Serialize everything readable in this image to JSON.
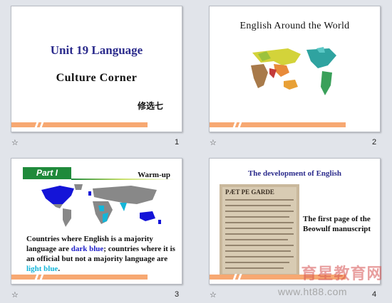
{
  "slides": [
    {
      "number": "1",
      "star": "☆",
      "title": "Unit 19 Language",
      "subtitle": "Culture Corner",
      "author": "修选七"
    },
    {
      "number": "2",
      "star": "☆",
      "title": "English Around the World"
    },
    {
      "number": "3",
      "star": "☆",
      "part_label": "Part I",
      "section": "Warm-up",
      "text_before": "Countries where English is a majority language are ",
      "dark_blue_text": "dark blue",
      "text_middle": "; countries where it is an official but not a majority language are ",
      "light_blue_text": "light blue",
      "text_after": "."
    },
    {
      "number": "4",
      "star": "☆",
      "title": "The development of English",
      "caption": "The first page of the Beowulf manuscript",
      "manuscript_heading": "PÆT PE GARDE"
    }
  ],
  "watermark": {
    "brand": "育星教育网",
    "url": "www.ht88.com"
  },
  "colors": {
    "title_blue": "#2b2b8c",
    "accent_orange": "#f7a872",
    "part_green": "#1f8a3b",
    "dark_blue": "#2020c8",
    "light_blue": "#14b5d8"
  }
}
